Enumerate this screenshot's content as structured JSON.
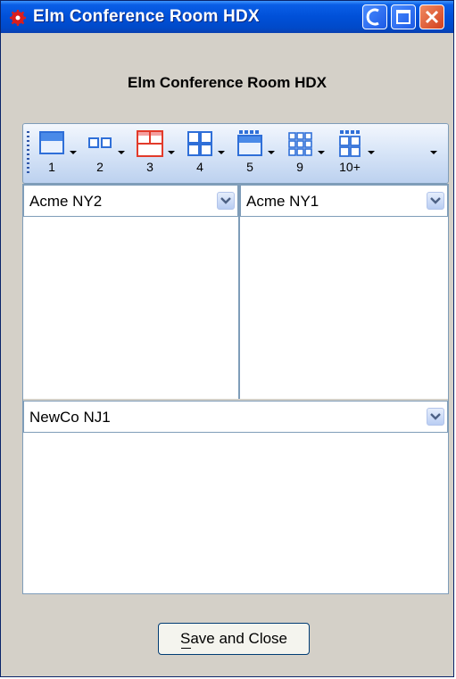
{
  "window": {
    "title": "Elm Conference Room HDX",
    "icon": "red-gear-icon",
    "controls": [
      "minimize",
      "maximize",
      "close"
    ]
  },
  "heading": "Elm Conference Room HDX",
  "layout_toolbar": {
    "buttons": [
      {
        "label": "1",
        "icon": "layout-1-icon",
        "selected": false
      },
      {
        "label": "2",
        "icon": "layout-2-icon",
        "selected": false
      },
      {
        "label": "3",
        "icon": "layout-3-icon",
        "selected": true
      },
      {
        "label": "4",
        "icon": "layout-4-icon",
        "selected": false
      },
      {
        "label": "5",
        "icon": "layout-5-icon",
        "selected": false
      },
      {
        "label": "9",
        "icon": "layout-9-icon",
        "selected": false
      },
      {
        "label": "10+",
        "icon": "layout-10plus-icon",
        "selected": false
      }
    ]
  },
  "panels": {
    "top_left": {
      "value": "Acme NY2"
    },
    "top_right": {
      "value": "Acme NY1"
    },
    "bottom": {
      "value": "NewCo NJ1"
    }
  },
  "save_button": {
    "label": "Save and Close",
    "mnemonic": "S"
  },
  "colors": {
    "titlebar": "#0050d8",
    "selected_layout": "#e23b2b",
    "layout_icon": "#2f6fd8",
    "toolbar_border": "#7f9db9"
  }
}
